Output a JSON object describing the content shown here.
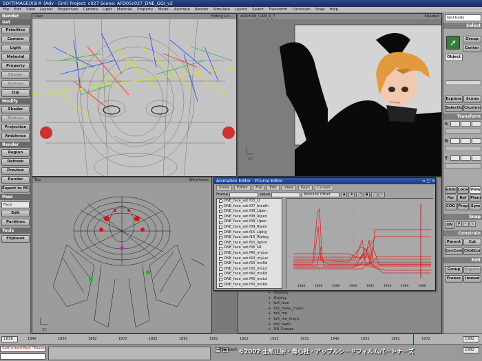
{
  "window": {
    "title": "SOFTIMAGE|XSI® (Adv - Eml) Project: c027   Scene: AFD05c027_DNE_GGI_v2"
  },
  "menu": [
    "File",
    "Edit",
    "View",
    "Layout",
    "Projectives",
    "Camera",
    "Light",
    "Material",
    "Property",
    "Model",
    "Animate",
    "Render",
    "Simulate",
    "Layers",
    "Select",
    "Transform",
    "Constrain",
    "Snap",
    "Help"
  ],
  "left_panel": {
    "mode": "Render",
    "get_title": "Get",
    "get_items": [
      "Primitive",
      "Camera",
      "Light",
      "Material",
      "Property",
      "Shader",
      "Texture",
      "Clip"
    ],
    "modify_title": "Modify",
    "modify_items": [
      "Shader",
      "Texture",
      "Projection",
      "Ambience"
    ],
    "render_title": "Render",
    "render_items": [
      "Region",
      "Refresh",
      "Preview",
      "Render",
      "Export to MI2"
    ],
    "pass_title": "Pass",
    "pass_value": "Face",
    "pass_items": [
      "Edit",
      "Partition"
    ],
    "tools_title": "Tools",
    "tools_items": [
      "Flipbook"
    ]
  },
  "right_panel": {
    "model_field": "GGI body",
    "select_title": "Select",
    "select_buttons": [
      "Group",
      "Center",
      "Object"
    ],
    "explore_buttons": [
      "Explore",
      "Scene",
      "Selection",
      "Clusters"
    ],
    "transform_title": "Transform",
    "transform_rows": [
      "S",
      "R",
      "T"
    ],
    "view_buttons": [
      "Global",
      "Local",
      "View",
      "Par",
      "Ref",
      "Plane",
      "COG",
      "Prop",
      "Sym"
    ],
    "snap_title": "Snap",
    "snap_on": "ON",
    "constrain_title": "Constrain",
    "constrain_buttons": [
      "Parent",
      "Cut",
      "CnsComp",
      "ChldComp"
    ],
    "edit_title": "Edit",
    "edit_buttons": [
      "Group",
      "Ungroup",
      "Freeze",
      "Immed"
    ]
  },
  "viewports": {
    "top_left": {
      "label": "User",
      "mode": "Hiding Lin..."
    },
    "top_right": {
      "label": "s00c000_CAM_0_T",
      "mode": "Shaded"
    },
    "bottom_left": {
      "label": "Top",
      "mode": "Wireframe"
    },
    "bottom_right": {
      "label": "",
      "mode": ""
    }
  },
  "anim_editor": {
    "title": "Animation Editor - FCurve Editor",
    "menus": [
      "Show",
      "Editor",
      "File",
      "Edit",
      "View",
      "Keys",
      "Curves"
    ],
    "frame_label": "Frame",
    "value_label": "Value",
    "offset_mode": "Absolute Offset",
    "axis_labels": [
      "Sx",
      "Sy",
      "Sz",
      "Tx",
      "Ty",
      "Tz"
    ],
    "channels": [
      "DNE_face_set:f03_Lt",
      "DNE_face_set:f07_breath",
      "DNE_face_set:f08_LIpen",
      "DNE_face_set:f08_RIpen",
      "DNE_face_set:f09_LIpen",
      "DNE_face_set:f09_RIpen",
      "DNE_face_set:f15_LIptlg",
      "DNE_face_set:f15_RIpteg",
      "DNE_face_set:f60_Iipbro",
      "DNE_face_set:f36_N1",
      "DNE_face_set:f40_myLar",
      "DNE_face_set:f43_myLar",
      "DNE_face_set:f30_moRd",
      "DNE_face_set:f30_moLcl",
      "DNE_face_set:f40_moRd",
      "DNE_face_set:f40_moLcl",
      "DNE_face_set:f30_moRd"
    ],
    "x_ticks": [
      "1840",
      "1860",
      "1880",
      "1900",
      "1920",
      "1940",
      "1960",
      "1980"
    ],
    "y_ticks": [
      "1",
      "0.8",
      "0.6",
      "0.4",
      "0.2",
      "0",
      "-0.2"
    ]
  },
  "explorer": {
    "items": [
      "Visibility",
      "Display",
      "toX_face",
      "toX_mayu_mayu",
      "toX_me",
      "toX_me_mayu",
      "toX_teeth",
      "DN_Groups"
    ]
  },
  "timeline": {
    "start": "1836",
    "end": "1982",
    "ticks": [
      "1840",
      "1850",
      "1862",
      "1872",
      "1882",
      "1892",
      "1902",
      "1912",
      "1922",
      "1932",
      "1942",
      "1952",
      "1962",
      "1972"
    ]
  },
  "status": {
    "command": "SetCurrentPass \"Passes.Face\"",
    "playback": "Playback",
    "frame": "1982",
    "copyright": "©2002 士郎正宗・青心社・アップルシードフィルムパートナーズ"
  }
}
